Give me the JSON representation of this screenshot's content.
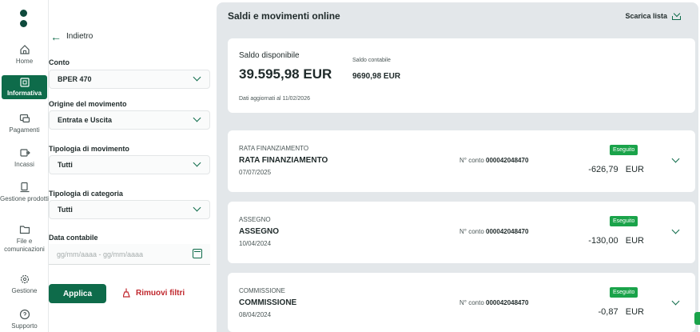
{
  "rail": {
    "items": [
      {
        "label": "Home",
        "icon": "home-icon"
      },
      {
        "label": "Informativa",
        "icon": "info-icon",
        "active": true
      },
      {
        "label": "Pagamenti",
        "icon": "payments-icon"
      },
      {
        "label": "Incassi",
        "icon": "collections-icon"
      },
      {
        "label": "Gestione prodotti",
        "icon": "products-icon"
      },
      {
        "label": "File e comunicazioni",
        "icon": "folder-icon"
      },
      {
        "label": "Gestione",
        "icon": "gear-icon"
      },
      {
        "label": "Supporto",
        "icon": "help-icon"
      }
    ]
  },
  "filters": {
    "back_label": "Indietro",
    "conto": {
      "label": "Conto",
      "value": "BPER 470"
    },
    "origine": {
      "label": "Origine del movimento",
      "value": "Entrata e Uscita"
    },
    "tipologia_movimento": {
      "label": "Tipologia di movimento",
      "value": "Tutti"
    },
    "tipologia_categoria": {
      "label": "Tipologia di categoria",
      "value": "Tutti"
    },
    "data_contabile": {
      "label": "Data contabile",
      "placeholder": "gg/mm/aaaa - gg/mm/aaaa"
    },
    "apply_label": "Applica",
    "clear_label": "Rimuovi filtri"
  },
  "main": {
    "title": "Saldi e movimenti online",
    "download_label": "Scarica lista",
    "balance": {
      "available_label": "Saldo disponibile",
      "available_value": "39.595,98 EUR",
      "accounting_label": "Saldo contabile",
      "accounting_value": "9690,98 EUR",
      "updated": "Dati aggiornati al 11/02/2026"
    },
    "movements": [
      {
        "category": "RATA FINANZIAMENTO",
        "description": "RATA FINANZIAMENTO",
        "date": "07/07/2025",
        "account_label": "N° conto",
        "account": "000042048470",
        "status": "Eseguito",
        "amount": "-626,79",
        "currency": "EUR"
      },
      {
        "category": "ASSEGNO",
        "description": "ASSEGNO",
        "date": "10/04/2024",
        "account_label": "N° conto",
        "account": "000042048470",
        "status": "Eseguito",
        "amount": "-130,00",
        "currency": "EUR"
      },
      {
        "category": "COMMISSIONE",
        "description": "COMMISSIONE",
        "date": "08/04/2024",
        "account_label": "N° conto",
        "account": "000042048470",
        "status": "Eseguito",
        "amount": "-0,87",
        "currency": "EUR"
      }
    ]
  },
  "colors": {
    "brand": "#0e6b4a",
    "accent_red": "#c0272d",
    "status_green": "#1aa34a",
    "main_bg": "#e3e7ea"
  }
}
